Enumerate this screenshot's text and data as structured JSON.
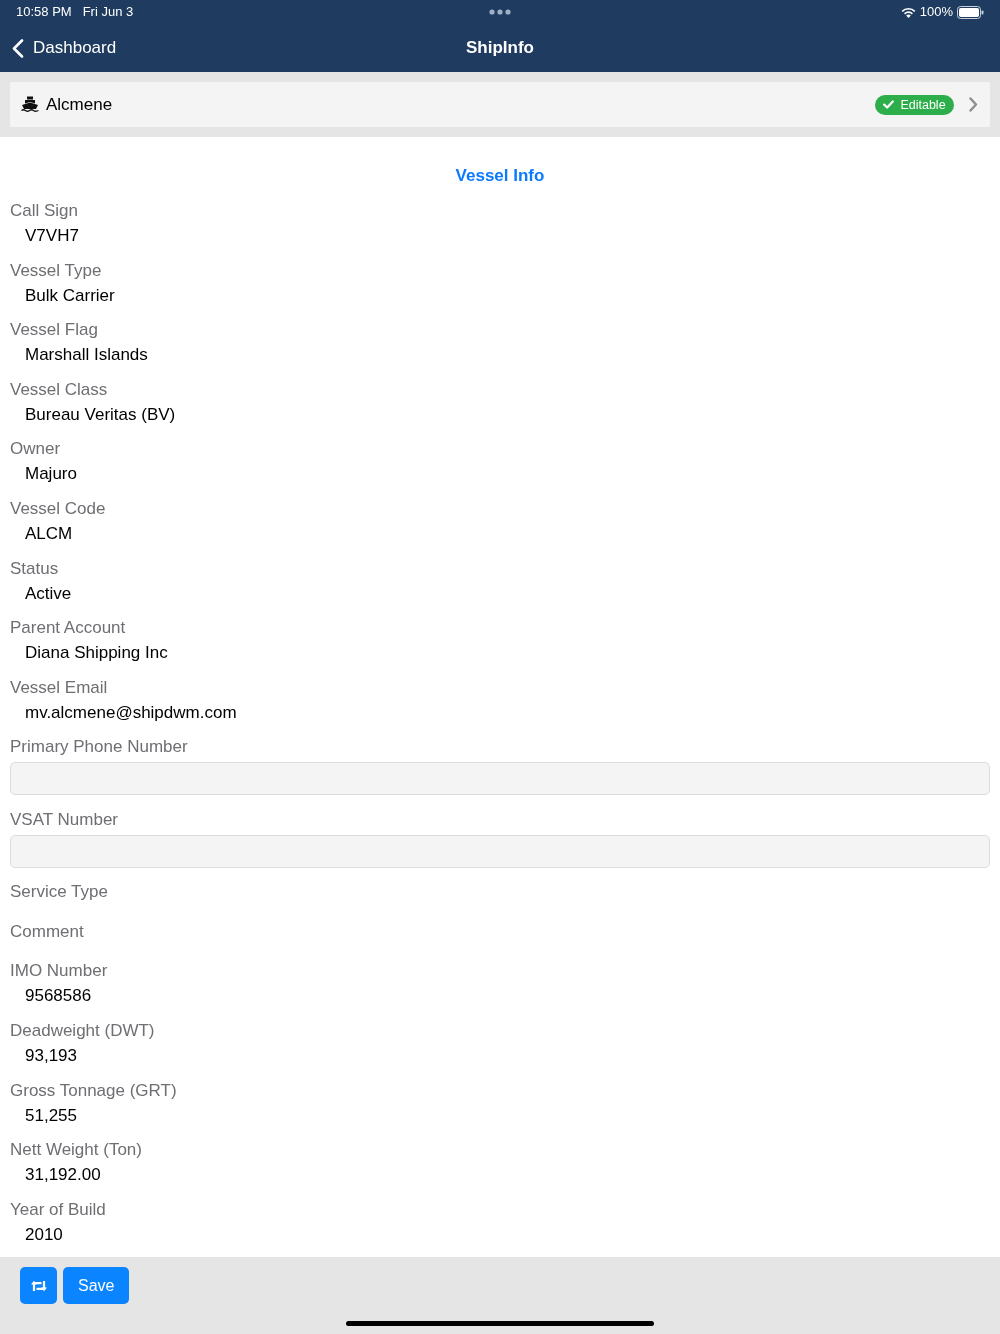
{
  "status_bar": {
    "time": "10:58 PM",
    "date": "Fri Jun 3",
    "battery": "100%"
  },
  "nav_bar": {
    "back_label": "Dashboard",
    "title": "ShipInfo"
  },
  "vessel_header": {
    "name": "Alcmene",
    "badge": "Editable"
  },
  "section_title": "Vessel Info",
  "fields": [
    {
      "kind": "text",
      "label": "Call Sign",
      "value": "V7VH7"
    },
    {
      "kind": "text",
      "label": "Vessel Type",
      "value": "Bulk Carrier"
    },
    {
      "kind": "text",
      "label": "Vessel Flag",
      "value": "Marshall Islands"
    },
    {
      "kind": "text",
      "label": "Vessel Class",
      "value": "Bureau Veritas (BV)"
    },
    {
      "kind": "text",
      "label": "Owner",
      "value": "Majuro"
    },
    {
      "kind": "text",
      "label": "Vessel Code",
      "value": "ALCM"
    },
    {
      "kind": "text",
      "label": "Status",
      "value": "Active"
    },
    {
      "kind": "text",
      "label": "Parent Account",
      "value": "Diana Shipping Inc"
    },
    {
      "kind": "text",
      "label": "Vessel Email",
      "value": "mv.alcmene@shipdwm.com"
    },
    {
      "kind": "input",
      "label": "Primary Phone Number"
    },
    {
      "kind": "input",
      "label": "VSAT Number"
    },
    {
      "kind": "empty",
      "label": "Service Type"
    },
    {
      "kind": "empty",
      "label": "Comment"
    },
    {
      "kind": "text",
      "label": "IMO Number",
      "value": "9568586"
    },
    {
      "kind": "text",
      "label": "Deadweight (DWT)",
      "value": "93,193"
    },
    {
      "kind": "text",
      "label": "Gross Tonnage (GRT)",
      "value": "51,255"
    },
    {
      "kind": "text",
      "label": "Nett Weight (Ton)",
      "value": "31,192.00"
    },
    {
      "kind": "text",
      "label": "Year of Build",
      "value": "2010"
    }
  ],
  "toolbar": {
    "buttons": [
      {
        "kind": "repeat"
      },
      {
        "kind": "text",
        "label": "Save"
      }
    ]
  }
}
